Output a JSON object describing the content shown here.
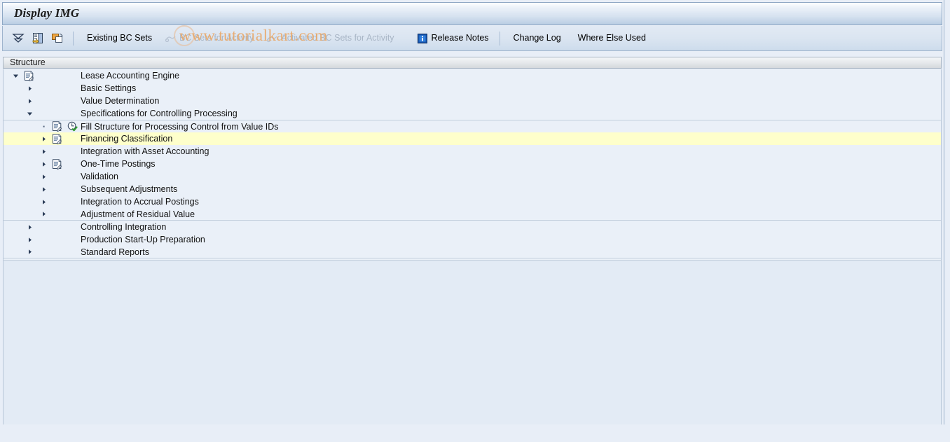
{
  "window": {
    "title": "Display IMG"
  },
  "watermark": {
    "text": "www.tutorialkart.com"
  },
  "toolbar": {
    "icons": [
      {
        "name": "expand-collapse-icon",
        "glyph": "collapse-all"
      },
      {
        "name": "select-subtree-icon",
        "glyph": "select-subtree"
      },
      {
        "name": "copy-icon",
        "glyph": "copy"
      }
    ],
    "buttons": [
      {
        "label": "Existing BC Sets",
        "icon": "",
        "disabled": false
      },
      {
        "label": "BC Sets for Activity",
        "icon": "bc-set-icon",
        "disabled": true
      },
      {
        "label": "Activated BC Sets for Activity",
        "icon": "bc-set-icon",
        "disabled": true
      },
      {
        "label": "Release Notes",
        "icon": "info-icon",
        "disabled": false
      },
      {
        "label": "Change Log",
        "icon": "",
        "disabled": false
      },
      {
        "label": "Where Else Used",
        "icon": "",
        "disabled": false
      }
    ]
  },
  "structure": {
    "header": "Structure",
    "rows": [
      {
        "label": "Lease Accounting Engine",
        "indent": 0,
        "twisty": "down",
        "doc": true,
        "clock": false,
        "highlight": false,
        "sep_top": false,
        "sep_bottom": false
      },
      {
        "label": "Basic Settings",
        "indent": 1,
        "twisty": "right",
        "doc": false,
        "clock": false,
        "highlight": false,
        "sep_top": false,
        "sep_bottom": false
      },
      {
        "label": "Value Determination",
        "indent": 1,
        "twisty": "right",
        "doc": false,
        "clock": false,
        "highlight": false,
        "sep_top": false,
        "sep_bottom": false
      },
      {
        "label": "Specifications for Controlling Processing",
        "indent": 1,
        "twisty": "down",
        "doc": false,
        "clock": false,
        "highlight": false,
        "sep_top": false,
        "sep_bottom": false
      },
      {
        "label": "Fill Structure for Processing Control from Value IDs",
        "indent": 2,
        "twisty": "dot",
        "doc": true,
        "clock": true,
        "highlight": false,
        "sep_top": true,
        "sep_bottom": false
      },
      {
        "label": "Financing Classification",
        "indent": 2,
        "twisty": "right",
        "doc": true,
        "clock": false,
        "highlight": true,
        "sep_top": false,
        "sep_bottom": false
      },
      {
        "label": "Integration with Asset Accounting",
        "indent": 2,
        "twisty": "right",
        "doc": false,
        "clock": false,
        "highlight": false,
        "sep_top": false,
        "sep_bottom": false
      },
      {
        "label": "One-Time Postings",
        "indent": 2,
        "twisty": "right",
        "doc": true,
        "clock": false,
        "highlight": false,
        "sep_top": false,
        "sep_bottom": false
      },
      {
        "label": "Validation",
        "indent": 2,
        "twisty": "right",
        "doc": false,
        "clock": false,
        "highlight": false,
        "sep_top": false,
        "sep_bottom": false
      },
      {
        "label": "Subsequent Adjustments",
        "indent": 2,
        "twisty": "right",
        "doc": false,
        "clock": false,
        "highlight": false,
        "sep_top": false,
        "sep_bottom": false
      },
      {
        "label": "Integration to Accrual Postings",
        "indent": 2,
        "twisty": "right",
        "doc": false,
        "clock": false,
        "highlight": false,
        "sep_top": false,
        "sep_bottom": false
      },
      {
        "label": "Adjustment of Residual Value",
        "indent": 2,
        "twisty": "right",
        "doc": false,
        "clock": false,
        "highlight": false,
        "sep_top": false,
        "sep_bottom": true
      },
      {
        "label": "Controlling Integration",
        "indent": 1,
        "twisty": "right",
        "doc": false,
        "clock": false,
        "highlight": false,
        "sep_top": false,
        "sep_bottom": false
      },
      {
        "label": "Production Start-Up Preparation",
        "indent": 1,
        "twisty": "right",
        "doc": false,
        "clock": false,
        "highlight": false,
        "sep_top": false,
        "sep_bottom": false
      },
      {
        "label": "Standard Reports",
        "indent": 1,
        "twisty": "right",
        "doc": false,
        "clock": false,
        "highlight": false,
        "sep_top": false,
        "sep_bottom": true
      }
    ]
  },
  "colors": {
    "title_bar": "#c3d5ea",
    "toolbar": "#d9e4f0",
    "tree_bg": "#eaf0f8",
    "highlight_row": "#feffcb",
    "watermark": "#e9a96a",
    "accent": "#1a4f9c"
  }
}
